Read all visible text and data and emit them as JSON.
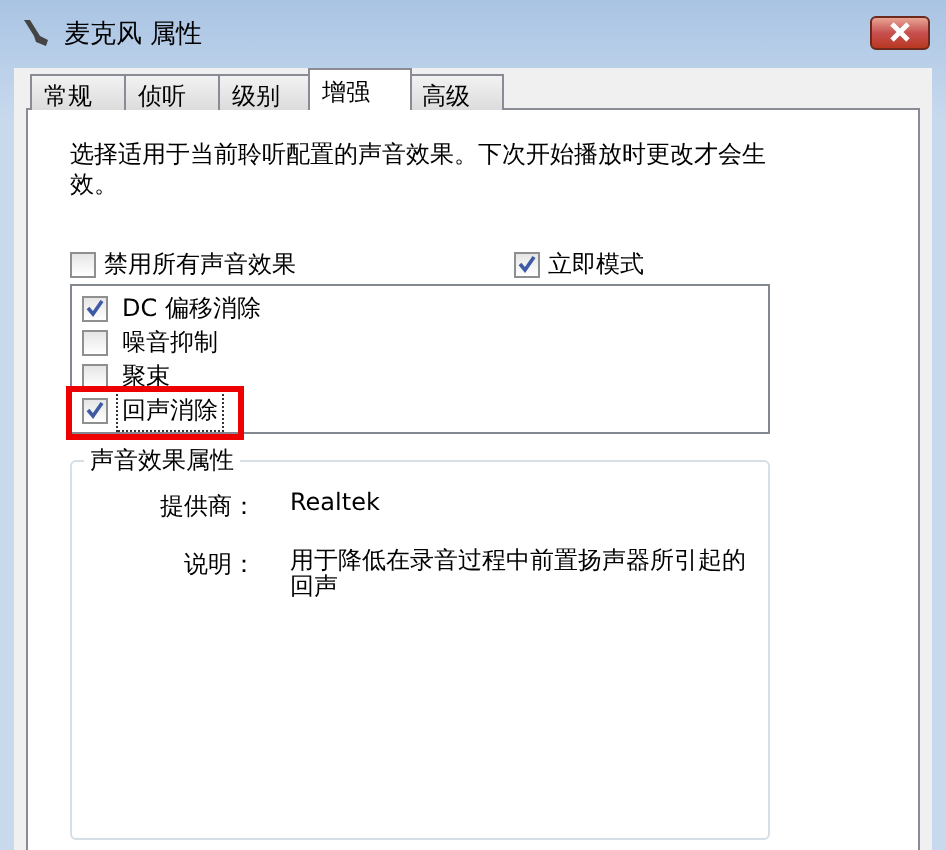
{
  "window": {
    "title": "麦克风 属性"
  },
  "tabs": [
    {
      "label": "常规",
      "selected": false
    },
    {
      "label": "侦听",
      "selected": false
    },
    {
      "label": "级别",
      "selected": false
    },
    {
      "label": "增强",
      "selected": true
    },
    {
      "label": "高级",
      "selected": false
    }
  ],
  "intro": "选择适用于当前聆听配置的声音效果。下次开始播放时更改才会生效。",
  "options": [
    {
      "label": "禁用所有声音效果",
      "checked": false
    },
    {
      "label": "立即模式",
      "checked": true
    }
  ],
  "effects": [
    {
      "label": "DC 偏移消除",
      "checked": true,
      "focused": false,
      "highlighted": false
    },
    {
      "label": "噪音抑制",
      "checked": false,
      "focused": false,
      "highlighted": false
    },
    {
      "label": "聚束",
      "checked": false,
      "focused": false,
      "highlighted": false
    },
    {
      "label": "回声消除",
      "checked": true,
      "focused": true,
      "highlighted": true
    }
  ],
  "properties": {
    "title": "声音效果属性",
    "rows": [
      {
        "label": "提供商：",
        "value": "Realtek"
      },
      {
        "label": "说明：",
        "value": "用于降低在录音过程中前置扬声器所引起的回声"
      }
    ]
  }
}
